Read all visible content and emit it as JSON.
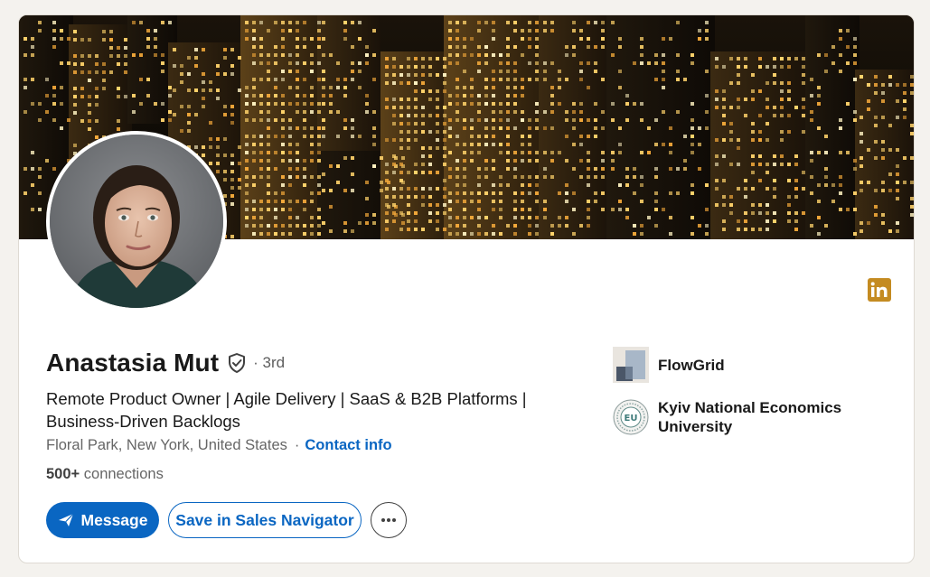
{
  "profile": {
    "name": "Anastasia Mut",
    "degree": "· 3rd",
    "headline": "Remote Product Owner | Agile Delivery | SaaS & B2B Platforms | Business-Driven Backlogs",
    "location": "Floral Park, New York, United States",
    "contact_label": "Contact info",
    "connections_count": "500+",
    "connections_label": "connections"
  },
  "actions": {
    "message_label": "Message",
    "save_label": "Save in Sales Navigator",
    "more_icon": "more-horizontal-icon"
  },
  "side": {
    "company": "FlowGrid",
    "school": "Kyiv National Economics University",
    "school_logo_text": "EU"
  },
  "icons": {
    "verified": "shield-check-icon",
    "linkedin": "linkedin-icon",
    "send": "paper-plane-icon"
  },
  "colors": {
    "primary": "#0a66c2",
    "linkedin_badge": "#c48b21",
    "page_bg": "#f4f2ee"
  }
}
